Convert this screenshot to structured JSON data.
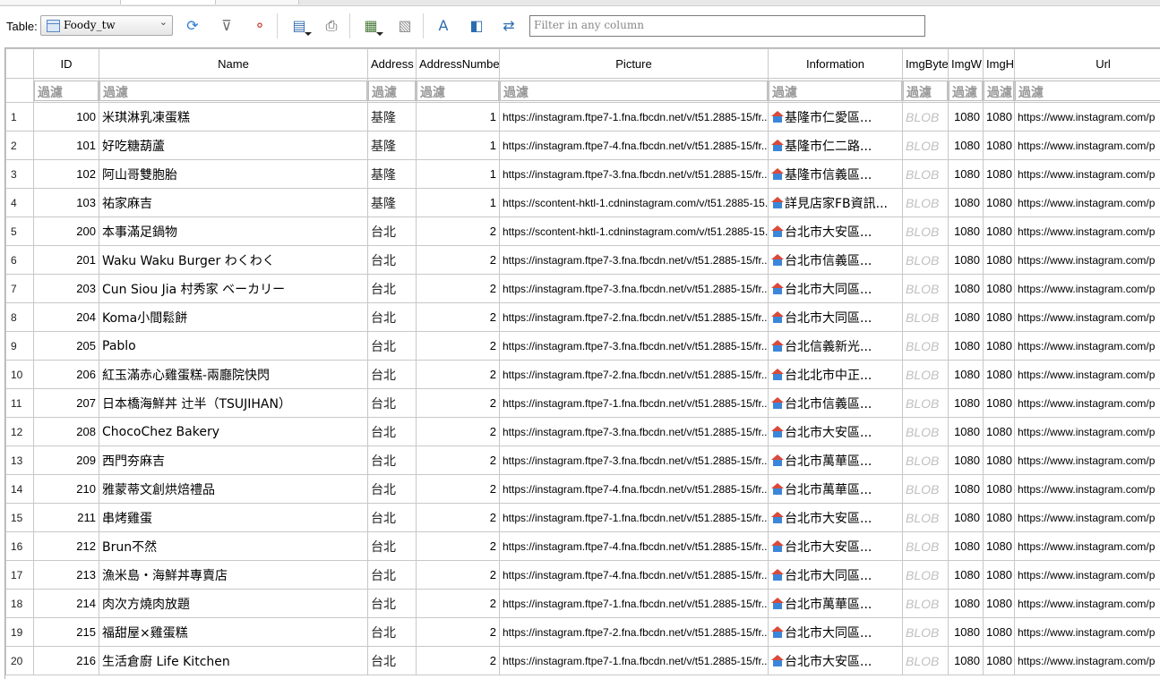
{
  "toolbar": {
    "table_label": "Table:",
    "table_value": "Foody_tw",
    "filter_placeholder": "Filter in any column",
    "buttons": [
      {
        "name": "refresh-button",
        "icon": "refresh-icon",
        "glyph": "⟳",
        "color": "#2a7fd4"
      },
      {
        "name": "clear-filters-button",
        "icon": "filter-clear-icon",
        "glyph": "⊽",
        "color": "#6e6e6e"
      },
      {
        "name": "save-filter-button",
        "icon": "filter-save-icon",
        "glyph": "⚬",
        "color": "#c0392b"
      },
      {
        "name": "insert-record-button",
        "icon": "insert-record-icon",
        "glyph": "▤",
        "color": "#3a6fb0"
      },
      {
        "name": "print-button",
        "icon": "printer-icon",
        "glyph": "⎙",
        "color": "#555555"
      },
      {
        "name": "new-record-button",
        "icon": "new-record-icon",
        "glyph": "▦",
        "color": "#4a7d3a"
      },
      {
        "name": "delete-record-button",
        "icon": "delete-record-icon",
        "glyph": "▧",
        "color": "#8c8c8c"
      },
      {
        "name": "find-button",
        "icon": "find-icon",
        "glyph": "A",
        "color": "#2b6cb0"
      },
      {
        "name": "find-replace-button",
        "icon": "find-replace-icon",
        "glyph": "◧",
        "color": "#2b6cb0"
      },
      {
        "name": "goto-cell-button",
        "icon": "goto-cell-icon",
        "glyph": "⇄",
        "color": "#2b6cb0"
      }
    ]
  },
  "grid": {
    "columns": [
      "ID",
      "Name",
      "Address",
      "AddressNumber",
      "Picture",
      "Information",
      "ImgByte",
      "ImgW",
      "ImgH",
      "Url"
    ],
    "filter_placeholders": [
      "過濾",
      "過濾",
      "過濾",
      "過濾",
      "過濾",
      "過濾",
      "過濾",
      "過濾",
      "過濾",
      "過濾"
    ],
    "rows": [
      {
        "rownum": "1",
        "id": "100",
        "name": "米琪淋乳凍蛋糕",
        "address": "基隆",
        "addressnumber": "1",
        "picture": "https://instagram.ftpe7-1.fna.fbcdn.net/v/t51.2885-15/fr...",
        "information": "基隆市仁愛區...",
        "imgbyte": "BLOB",
        "imgw": "1080",
        "imgh": "1080",
        "url": "https://www.instagram.com/p"
      },
      {
        "rownum": "2",
        "id": "101",
        "name": "好吃糖葫蘆",
        "address": "基隆",
        "addressnumber": "1",
        "picture": "https://instagram.ftpe7-4.fna.fbcdn.net/v/t51.2885-15/fr...",
        "information": "基隆市仁二路...",
        "imgbyte": "BLOB",
        "imgw": "1080",
        "imgh": "1080",
        "url": "https://www.instagram.com/p"
      },
      {
        "rownum": "3",
        "id": "102",
        "name": "阿山哥雙胞胎",
        "address": "基隆",
        "addressnumber": "1",
        "picture": "https://instagram.ftpe7-3.fna.fbcdn.net/v/t51.2885-15/fr...",
        "information": "基隆市信義區...",
        "imgbyte": "BLOB",
        "imgw": "1080",
        "imgh": "1080",
        "url": "https://www.instagram.com/p"
      },
      {
        "rownum": "4",
        "id": "103",
        "name": "祐家麻吉",
        "address": "基隆",
        "addressnumber": "1",
        "picture": "https://scontent-hktl-1.cdninstagram.com/v/t51.2885-15...",
        "information": "詳見店家FB資訊...",
        "imgbyte": "BLOB",
        "imgw": "1080",
        "imgh": "1080",
        "url": "https://www.instagram.com/p"
      },
      {
        "rownum": "5",
        "id": "200",
        "name": "本事滿足鍋物",
        "address": "台北",
        "addressnumber": "2",
        "picture": "https://scontent-hktl-1.cdninstagram.com/v/t51.2885-15...",
        "information": "台北市大安區...",
        "imgbyte": "BLOB",
        "imgw": "1080",
        "imgh": "1080",
        "url": "https://www.instagram.com/p"
      },
      {
        "rownum": "6",
        "id": "201",
        "name": "Waku Waku Burger わくわく",
        "address": "台北",
        "addressnumber": "2",
        "picture": "https://instagram.ftpe7-3.fna.fbcdn.net/v/t51.2885-15/fr...",
        "information": "台北市信義區...",
        "imgbyte": "BLOB",
        "imgw": "1080",
        "imgh": "1080",
        "url": "https://www.instagram.com/p"
      },
      {
        "rownum": "7",
        "id": "203",
        "name": "Cun Siou Jia 村秀家 ベーカリー",
        "address": "台北",
        "addressnumber": "2",
        "picture": "https://instagram.ftpe7-3.fna.fbcdn.net/v/t51.2885-15/fr...",
        "information": "台北市大同區...",
        "imgbyte": "BLOB",
        "imgw": "1080",
        "imgh": "1080",
        "url": "https://www.instagram.com/p"
      },
      {
        "rownum": "8",
        "id": "204",
        "name": "Koma小間鬆餅",
        "address": "台北",
        "addressnumber": "2",
        "picture": "https://instagram.ftpe7-2.fna.fbcdn.net/v/t51.2885-15/fr...",
        "information": "台北市大同區...",
        "imgbyte": "BLOB",
        "imgw": "1080",
        "imgh": "1080",
        "url": "https://www.instagram.com/p"
      },
      {
        "rownum": "9",
        "id": "205",
        "name": "Pablo",
        "address": "台北",
        "addressnumber": "2",
        "picture": "https://instagram.ftpe7-3.fna.fbcdn.net/v/t51.2885-15/fr...",
        "information": "台北信義新光...",
        "imgbyte": "BLOB",
        "imgw": "1080",
        "imgh": "1080",
        "url": "https://www.instagram.com/p"
      },
      {
        "rownum": "10",
        "id": "206",
        "name": "紅玉滿赤心雞蛋糕-兩廳院快閃",
        "address": "台北",
        "addressnumber": "2",
        "picture": "https://instagram.ftpe7-2.fna.fbcdn.net/v/t51.2885-15/fr...",
        "information": "台北北市中正...",
        "imgbyte": "BLOB",
        "imgw": "1080",
        "imgh": "1080",
        "url": "https://www.instagram.com/p"
      },
      {
        "rownum": "11",
        "id": "207",
        "name": "日本橋海鮮丼 辻半（TSUJIHAN）",
        "address": "台北",
        "addressnumber": "2",
        "picture": "https://instagram.ftpe7-1.fna.fbcdn.net/v/t51.2885-15/fr...",
        "information": "台北市信義區...",
        "imgbyte": "BLOB",
        "imgw": "1080",
        "imgh": "1080",
        "url": "https://www.instagram.com/p"
      },
      {
        "rownum": "12",
        "id": "208",
        "name": "ChocoChez Bakery",
        "address": "台北",
        "addressnumber": "2",
        "picture": "https://instagram.ftpe7-3.fna.fbcdn.net/v/t51.2885-15/fr...",
        "information": "台北市大安區...",
        "imgbyte": "BLOB",
        "imgw": "1080",
        "imgh": "1080",
        "url": "https://www.instagram.com/p"
      },
      {
        "rownum": "13",
        "id": "209",
        "name": "西門夯麻吉",
        "address": "台北",
        "addressnumber": "2",
        "picture": "https://instagram.ftpe7-3.fna.fbcdn.net/v/t51.2885-15/fr...",
        "information": "台北市萬華區...",
        "imgbyte": "BLOB",
        "imgw": "1080",
        "imgh": "1080",
        "url": "https://www.instagram.com/p"
      },
      {
        "rownum": "14",
        "id": "210",
        "name": "雅蒙蒂文創烘焙禮品",
        "address": "台北",
        "addressnumber": "2",
        "picture": "https://instagram.ftpe7-4.fna.fbcdn.net/v/t51.2885-15/fr...",
        "information": "台北市萬華區...",
        "imgbyte": "BLOB",
        "imgw": "1080",
        "imgh": "1080",
        "url": "https://www.instagram.com/p"
      },
      {
        "rownum": "15",
        "id": "211",
        "name": "串烤雞蛋",
        "address": "台北",
        "addressnumber": "2",
        "picture": "https://instagram.ftpe7-1.fna.fbcdn.net/v/t51.2885-15/fr...",
        "information": "台北市大安區...",
        "imgbyte": "BLOB",
        "imgw": "1080",
        "imgh": "1080",
        "url": "https://www.instagram.com/p"
      },
      {
        "rownum": "16",
        "id": "212",
        "name": "Brun不然",
        "address": "台北",
        "addressnumber": "2",
        "picture": "https://instagram.ftpe7-4.fna.fbcdn.net/v/t51.2885-15/fr...",
        "information": "台北市大安區...",
        "imgbyte": "BLOB",
        "imgw": "1080",
        "imgh": "1080",
        "url": "https://www.instagram.com/p"
      },
      {
        "rownum": "17",
        "id": "213",
        "name": "漁米島・海鮮丼專賣店",
        "address": "台北",
        "addressnumber": "2",
        "picture": "https://instagram.ftpe7-4.fna.fbcdn.net/v/t51.2885-15/fr...",
        "information": "台北市大同區...",
        "imgbyte": "BLOB",
        "imgw": "1080",
        "imgh": "1080",
        "url": "https://www.instagram.com/p"
      },
      {
        "rownum": "18",
        "id": "214",
        "name": "肉次方燒肉放題",
        "address": "台北",
        "addressnumber": "2",
        "picture": "https://instagram.ftpe7-1.fna.fbcdn.net/v/t51.2885-15/fr...",
        "information": "台北市萬華區...",
        "imgbyte": "BLOB",
        "imgw": "1080",
        "imgh": "1080",
        "url": "https://www.instagram.com/p"
      },
      {
        "rownum": "19",
        "id": "215",
        "name": "福甜屋×雞蛋糕",
        "address": "台北",
        "addressnumber": "2",
        "picture": "https://instagram.ftpe7-2.fna.fbcdn.net/v/t51.2885-15/fr...",
        "information": "台北市大同區...",
        "imgbyte": "BLOB",
        "imgw": "1080",
        "imgh": "1080",
        "url": "https://www.instagram.com/p"
      },
      {
        "rownum": "20",
        "id": "216",
        "name": "生活倉廚 Life Kitchen",
        "address": "台北",
        "addressnumber": "2",
        "picture": "https://instagram.ftpe7-1.fna.fbcdn.net/v/t51.2885-15/fr...",
        "information": "台北市大安區...",
        "imgbyte": "BLOB",
        "imgw": "1080",
        "imgh": "1080",
        "url": "https://www.instagram.com/p"
      }
    ]
  }
}
